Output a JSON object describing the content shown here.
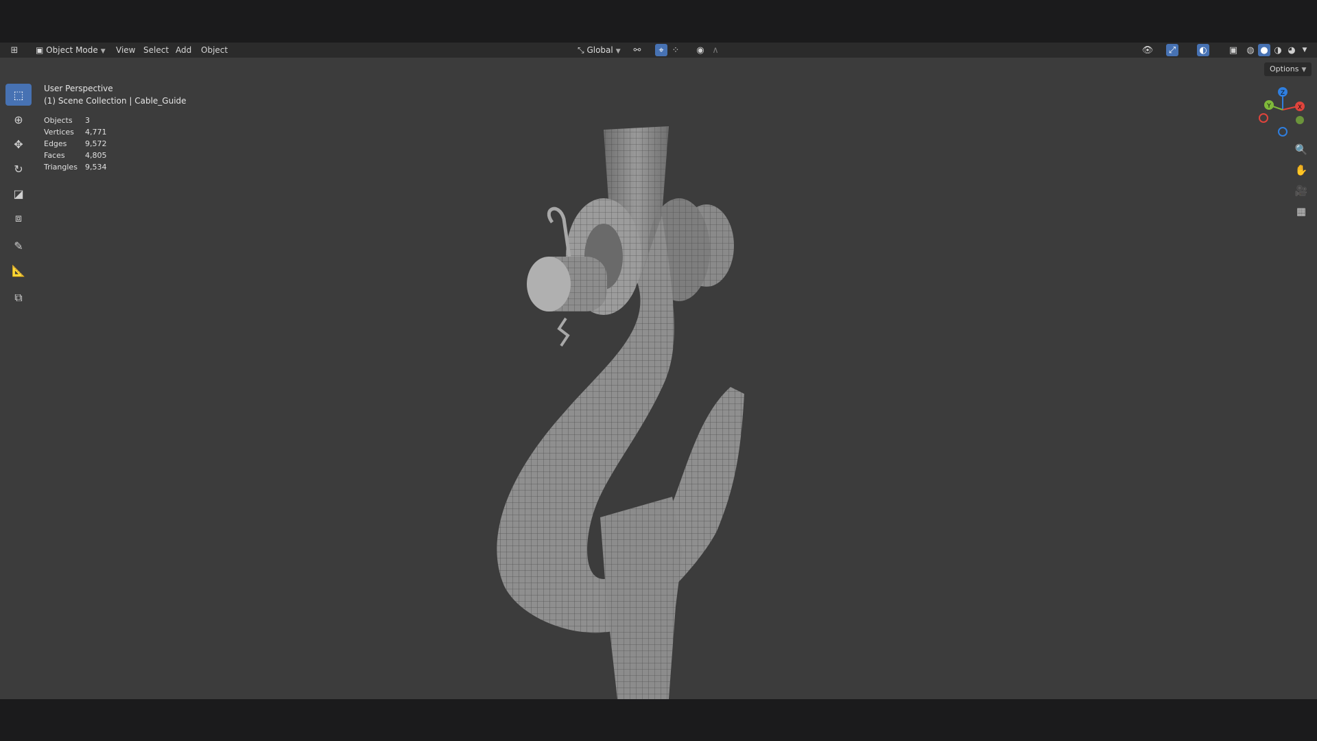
{
  "header": {
    "mode_label": "Object Mode",
    "menu": [
      "View",
      "Select",
      "Add",
      "Object"
    ],
    "orientation_label": "Global"
  },
  "overlay": {
    "perspective": "User Perspective",
    "collection": "(1) Scene Collection | Cable_Guide",
    "stats": [
      {
        "label": "Objects",
        "value": "3"
      },
      {
        "label": "Vertices",
        "value": "4,771"
      },
      {
        "label": "Edges",
        "value": "9,572"
      },
      {
        "label": "Faces",
        "value": "4,805"
      },
      {
        "label": "Triangles",
        "value": "9,534"
      }
    ]
  },
  "options_label": "Options",
  "gizmo": {
    "x": "X",
    "y": "Y",
    "z": "Z"
  },
  "colors": {
    "accent": "#4772b3",
    "viewport": "#3c3c3c",
    "x_axis": "#e0443c",
    "y_axis": "#7fb93a",
    "z_axis": "#2f7fe0"
  }
}
